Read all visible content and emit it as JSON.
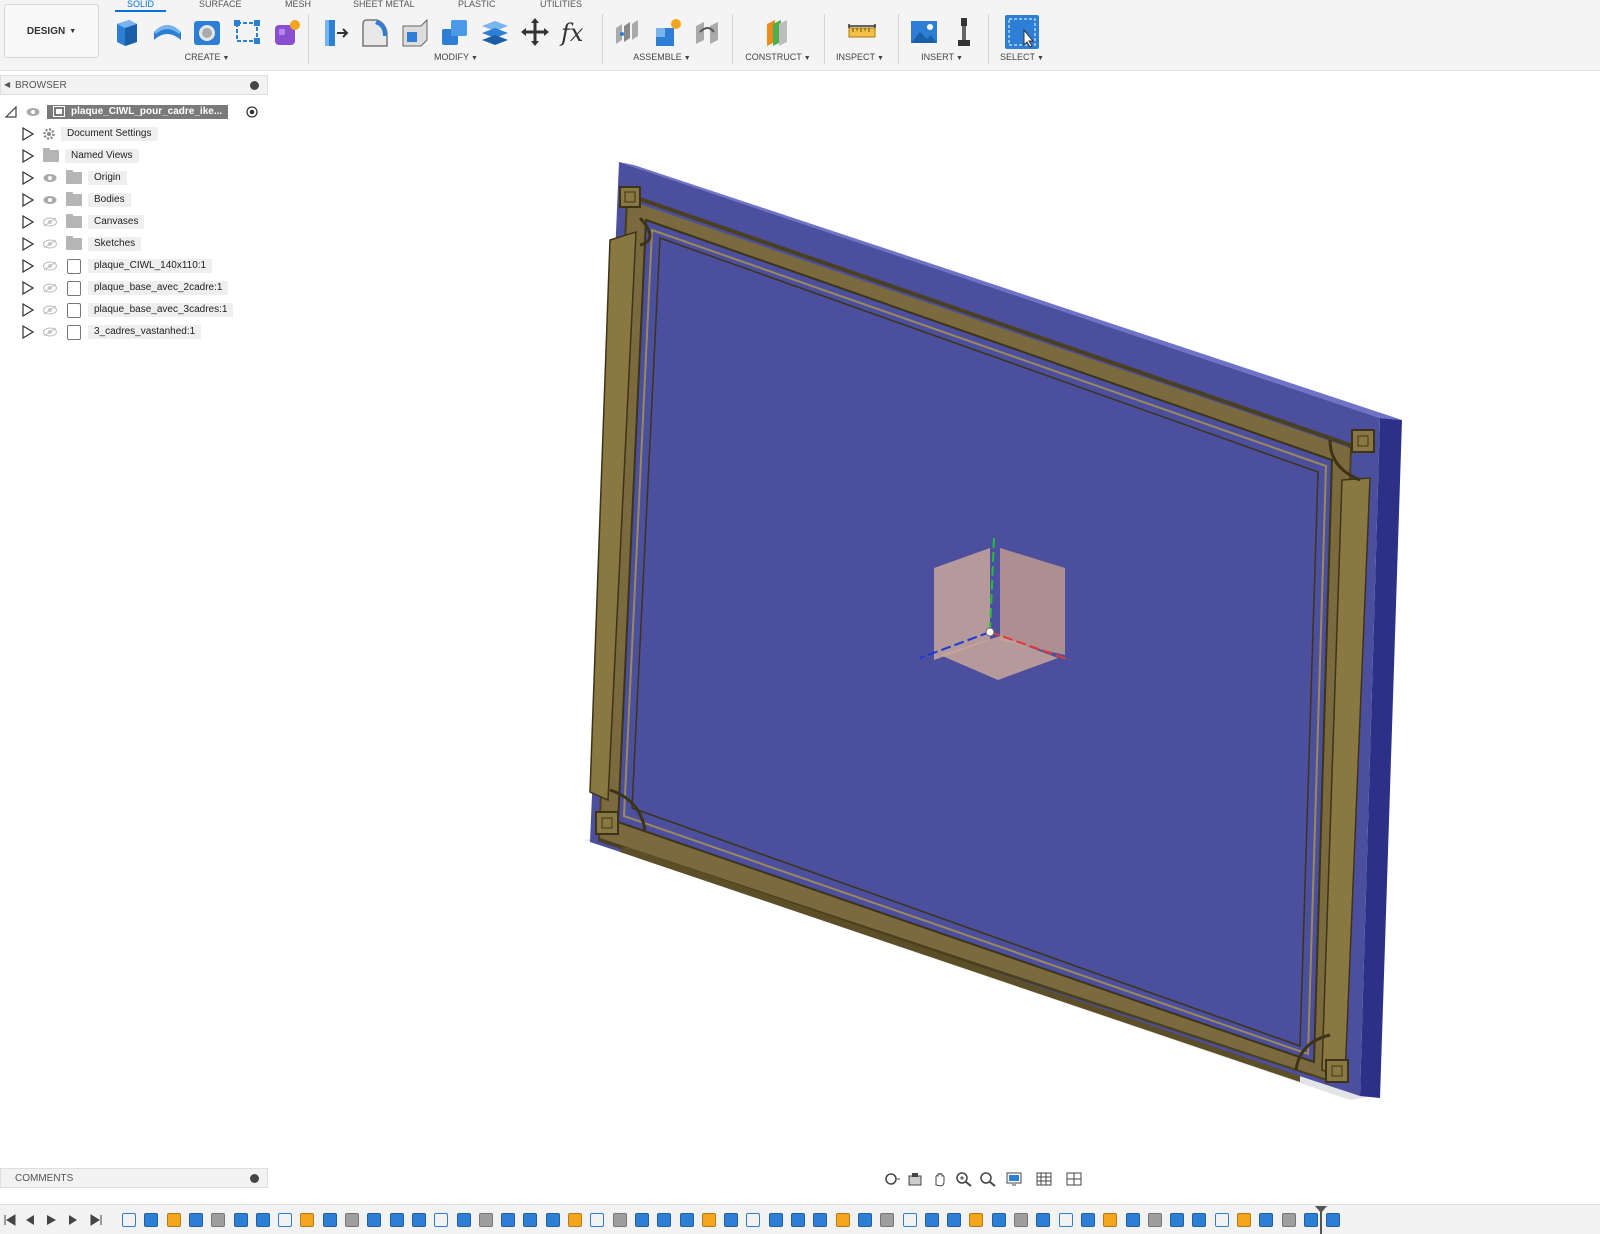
{
  "toolbar": {
    "workspace_label": "DESIGN",
    "tabs": [
      "SOLID",
      "SURFACE",
      "MESH",
      "SHEET METAL",
      "PLASTIC",
      "UTILITIES"
    ],
    "groups": {
      "create": "CREATE",
      "modify": "MODIFY",
      "assemble": "ASSEMBLE",
      "construct": "CONSTRUCT",
      "inspect": "INSPECT",
      "insert": "INSERT",
      "select": "SELECT"
    },
    "icons": {
      "create": [
        "new-component-icon",
        "extrude-icon",
        "revolve-icon",
        "hole-icon",
        "sketch-icon",
        "form-icon"
      ],
      "modify": [
        "press-pull-icon",
        "fillet-icon",
        "shell-icon",
        "combine-icon",
        "offset-face-icon",
        "move-icon",
        "parameters-fx-icon"
      ],
      "assemble": [
        "joint-icon",
        "new-component-assemble-icon",
        "as-built-joint-icon"
      ],
      "construct": [
        "offset-plane-icon"
      ],
      "inspect": [
        "measure-icon"
      ],
      "insert": [
        "insert-image-icon",
        "insert-mcmaster-icon"
      ],
      "select": [
        "select-window-icon"
      ]
    },
    "accent": "#0a72d6"
  },
  "browser": {
    "header": "BROWSER",
    "root": "plaque_CIWL_pour_cadre_ike...",
    "items": [
      {
        "label": "Document Settings",
        "icon": "gear-icon"
      },
      {
        "label": "Named Views",
        "icon": "folder-icon"
      },
      {
        "label": "Origin",
        "icon": "folder-icon"
      },
      {
        "label": "Bodies",
        "icon": "folder-icon"
      },
      {
        "label": "Canvases",
        "icon": "folder-icon"
      },
      {
        "label": "Sketches",
        "icon": "folder-icon"
      },
      {
        "label": "plaque_CIWL_140x110:1",
        "icon": "component-icon"
      },
      {
        "label": "plaque_base_avec_2cadre:1",
        "icon": "component-icon"
      },
      {
        "label": "plaque_base_avec_3cadres:1",
        "icon": "component-icon"
      },
      {
        "label": "3_cadres_vastanhed:1",
        "icon": "component-icon"
      }
    ]
  },
  "viewport": {
    "plate_color": "#4b4f9e",
    "frame_color": "#7a6a3e",
    "origin_cube_color": "#c9a69a"
  },
  "comments": {
    "label": "COMMENTS"
  },
  "navbar": {
    "icons": [
      "orbit-icon",
      "look-at-icon",
      "pan-icon",
      "zoom-icon",
      "fit-icon",
      "display-settings-icon",
      "grid-icon",
      "viewports-icon"
    ]
  },
  "timeline": {
    "controls": [
      "go-to-start-icon",
      "step-back-icon",
      "play-icon",
      "step-forward-icon",
      "go-to-end-icon"
    ],
    "feature_count": 55
  }
}
